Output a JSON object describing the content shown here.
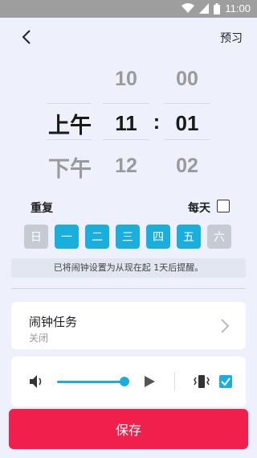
{
  "status_bar": {
    "time": "11:00",
    "wifi_icon": "wifi-icon",
    "signal_icon": "signal-icon",
    "battery_icon": "battery-icon"
  },
  "header": {
    "back_icon": "back-arrow-icon",
    "preview_label": "预习"
  },
  "picker": {
    "ampm": {
      "selected": "上午",
      "next": "下午"
    },
    "hours": {
      "prev": "10",
      "selected": "11",
      "next": "12"
    },
    "separator": ":",
    "minutes": {
      "prev": "00",
      "selected": "01",
      "next": "02"
    }
  },
  "repeat": {
    "label": "重复",
    "everyday_label": "每天",
    "everyday_checked": false,
    "days": [
      {
        "label": "日",
        "selected": false
      },
      {
        "label": "一",
        "selected": true
      },
      {
        "label": "二",
        "selected": true
      },
      {
        "label": "三",
        "selected": true
      },
      {
        "label": "四",
        "selected": true
      },
      {
        "label": "五",
        "selected": true
      },
      {
        "label": "六",
        "selected": false
      }
    ]
  },
  "hint": "已将闹钟设置为从现在起 1天后提醒。",
  "alarm_task": {
    "title": "闹钟任务",
    "status": "关闭",
    "chevron_icon": "chevron-right-icon"
  },
  "sound": {
    "volume_icon": "volume-icon",
    "volume_fraction": 1.0,
    "play_icon": "play-icon",
    "vibrate_icon": "vibrate-icon",
    "vibrate_checked": true
  },
  "save_label": "保存",
  "colors": {
    "accent": "#1aaedc",
    "save": "#f11f4b",
    "day_off": "#c6cad3"
  }
}
